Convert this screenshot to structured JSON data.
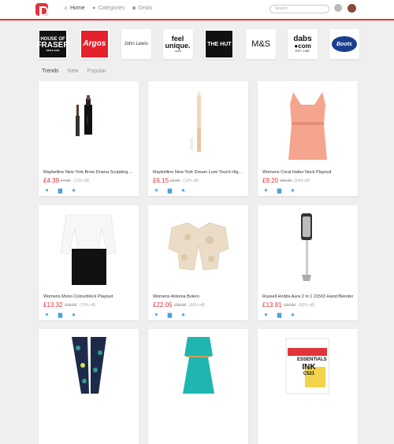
{
  "header": {
    "nav": [
      {
        "label": "Home",
        "icon": "home-icon"
      },
      {
        "label": "Categories",
        "icon": "tag-icon"
      },
      {
        "label": "Deals",
        "icon": "tag-icon"
      }
    ],
    "search_placeholder": "Search"
  },
  "stores": [
    {
      "name": "House of Fraser",
      "line1": "HOUSE OF",
      "line2": "FRASER",
      "line3": "SINCE 1849"
    },
    {
      "name": "Argos",
      "label": "Argos"
    },
    {
      "name": "John Lewis",
      "label": "John Lewis"
    },
    {
      "name": "feel unique",
      "line1": "feel",
      "line2": "unique.",
      "line3": ".com"
    },
    {
      "name": "The Hut",
      "label": "THE HUT"
    },
    {
      "name": "M&S",
      "label": "M&S"
    },
    {
      "name": "dabs.com",
      "line1": "dabs",
      "line2": "●com",
      "line3": "EST. 1987"
    },
    {
      "name": "Boots",
      "label": "Boots"
    }
  ],
  "tabs": [
    "Trends",
    "New",
    "Popular"
  ],
  "products": [
    {
      "title": "Maybelline New York Brow Drama Sculpting ...",
      "price": "£4.39",
      "old": "£7.99",
      "off": "(12% off)"
    },
    {
      "title": "Maybelline New York Dream Lumi Touch Hig...",
      "price": "£6.15",
      "old": "£6.99",
      "off": "(12% off)"
    },
    {
      "title": "Womens Coral Halter Neck Playsuit",
      "price": "£9.20",
      "old": "£20.00",
      "off": "(54% off)"
    },
    {
      "title": "Womens Mono Colourblock Playsuit",
      "price": "£13.32",
      "old": "£45.00",
      "off": "(70% off)"
    },
    {
      "title": "Womens Antonia Bolero",
      "price": "£22.05",
      "old": "£65.00",
      "off": "(66% off)"
    },
    {
      "title": "Russell Hobbs Aura 2 in 1 21503 Hand Blender",
      "price": "£13.91",
      "old": "£34.99",
      "off": "(60% off)"
    },
    {
      "title": "",
      "price": "",
      "old": "",
      "off": ""
    },
    {
      "title": "",
      "price": "",
      "old": "",
      "off": ""
    },
    {
      "title": "",
      "price": "",
      "old": "",
      "off": "",
      "badge1": "ESSENTIALS",
      "badge2": "INK",
      "badge3": "C521"
    }
  ],
  "colors": {
    "accent": "#e0333a",
    "action": "#4aa3d8"
  }
}
